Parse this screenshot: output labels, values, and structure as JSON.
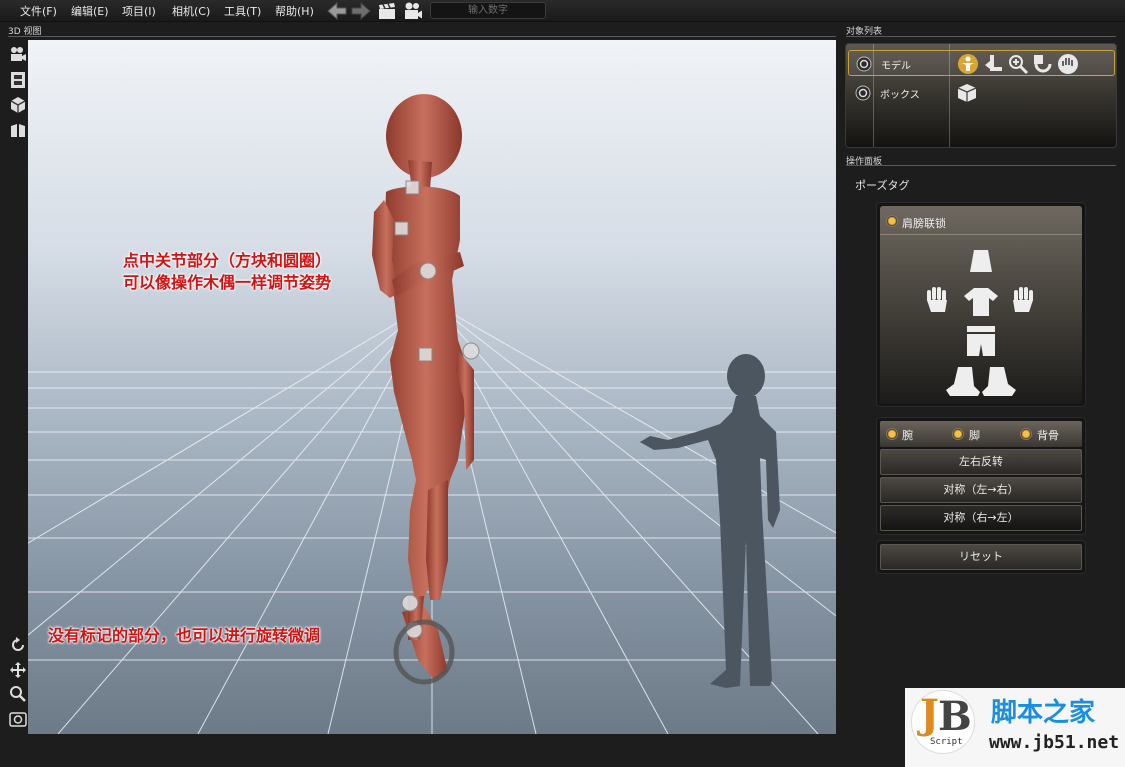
{
  "menu": [
    "文件(F)",
    "编辑(E)",
    "项目(I)",
    "相机(C)",
    "工具(T)",
    "帮助(H)"
  ],
  "toolbar": {
    "icons": [
      "back-arrow-icon",
      "forward-arrow-icon",
      "clapper-icon",
      "camera-icon"
    ],
    "input_placeholder": "输入数字"
  },
  "viewport": {
    "label": "3D 视图",
    "annotation_top_line1": "点中关节部分（方块和圆圈）",
    "annotation_top_line2": "可以像操作木偶一样调节姿势",
    "annotation_bottom": "没有标记的部分，也可以进行旋转微调"
  },
  "left_tools_top": [
    "movie-camera-icon",
    "film-strip-icon",
    "cube-icon",
    "layout-icon"
  ],
  "left_tools_bottom": [
    "rotate-icon",
    "move-icon",
    "zoom-icon",
    "screenshot-icon"
  ],
  "object_list": {
    "label": "对象列表",
    "items": [
      {
        "name": "モデル",
        "selected": true
      },
      {
        "name": "ボックス",
        "selected": false
      }
    ]
  },
  "operation_panel": {
    "label": "操作面板",
    "pose_tag_title": "ポーズタグ",
    "shoulder_lock_label": "肩膀联锁",
    "options": [
      "腕",
      "脚",
      "背骨"
    ],
    "buttons": {
      "mirror": "左右反转",
      "sym_lr": "对称（左→右）",
      "sym_rl": "对称（右→左）",
      "reset": "リセット"
    }
  },
  "watermark": {
    "site_name": "脚本之家",
    "url": "www.jb51.net",
    "logo_text": "Script"
  },
  "colors": {
    "accent": "#c9a13a",
    "annotation": "#d21414",
    "model": "#b34f3f"
  }
}
